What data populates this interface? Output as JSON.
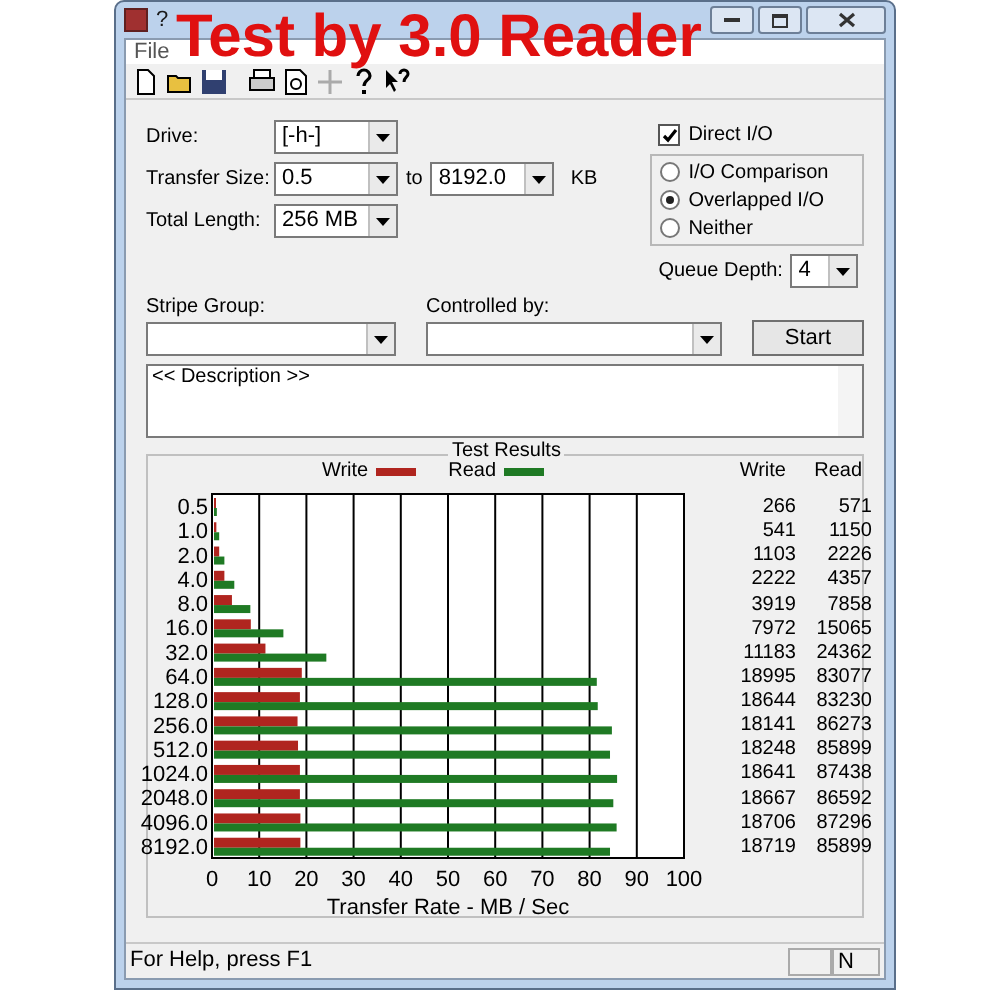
{
  "window": {
    "title_start": "?"
  },
  "overlay_text": "Test by 3.0 Reader",
  "menu": [
    "File"
  ],
  "form": {
    "drive": {
      "label": "Drive:",
      "value": "[-h-]"
    },
    "transfer_size": {
      "label": "Transfer Size:",
      "from": "0.5",
      "to_label": "to",
      "to": "8192.0",
      "unit": "KB"
    },
    "total_length": {
      "label": "Total Length:",
      "value": "256 MB"
    },
    "direct_io": {
      "label": "Direct I/O",
      "checked": true
    },
    "io_modes": [
      {
        "label": "I/O Comparison",
        "selected": false
      },
      {
        "label": "Overlapped I/O",
        "selected": true
      },
      {
        "label": "Neither",
        "selected": false
      }
    ],
    "queue_depth": {
      "label": "Queue Depth:",
      "value": "4"
    },
    "stripe_group": {
      "label": "Stripe Group:"
    },
    "controlled_by": {
      "label": "Controlled by:"
    },
    "start_button": "Start",
    "description": "<< Description >>"
  },
  "results": {
    "title": "Test Results",
    "columns": [
      "Write",
      "Read"
    ],
    "rows": [
      {
        "write": "266",
        "read": "571"
      },
      {
        "write": "541",
        "read": "1150"
      },
      {
        "write": "1103",
        "read": "2226"
      },
      {
        "write": "2222",
        "read": "4357"
      },
      {
        "write": "3919",
        "read": "7858"
      },
      {
        "write": "7972",
        "read": "15065"
      },
      {
        "write": "11183",
        "read": "24362"
      },
      {
        "write": "18995",
        "read": "83077"
      },
      {
        "write": "18644",
        "read": "83230"
      },
      {
        "write": "18141",
        "read": "86273"
      },
      {
        "write": "18248",
        "read": "85899"
      },
      {
        "write": "18641",
        "read": "87438"
      },
      {
        "write": "18667",
        "read": "86592"
      },
      {
        "write": "18706",
        "read": "87296"
      },
      {
        "write": "18719",
        "read": "85899"
      }
    ],
    "chart_data": {
      "type": "bar",
      "orientation": "horizontal",
      "xlabel": "Transfer Rate - MB / Sec",
      "categories": [
        "0.5",
        "1.0",
        "2.0",
        "4.0",
        "8.0",
        "16.0",
        "32.0",
        "64.0",
        "128.0",
        "256.0",
        "512.0",
        "1024.0",
        "2048.0",
        "4096.0",
        "8192.0"
      ],
      "series": [
        {
          "name": "Write",
          "color": "#b0251f",
          "values": [
            0.3,
            0.5,
            1.1,
            2.2,
            3.8,
            7.8,
            10.9,
            18.6,
            18.2,
            17.7,
            17.8,
            18.2,
            18.2,
            18.3,
            18.3
          ]
        },
        {
          "name": "Read",
          "color": "#1f7a24",
          "values": [
            0.6,
            1.1,
            2.2,
            4.3,
            7.7,
            14.7,
            23.8,
            81.1,
            81.3,
            84.3,
            83.9,
            85.4,
            84.6,
            85.3,
            83.9
          ]
        }
      ],
      "xlim": [
        0,
        100
      ],
      "xticks": [
        0,
        10,
        20,
        30,
        40,
        50,
        60,
        70,
        80,
        90,
        100
      ],
      "grid": true
    }
  },
  "status_bar": {
    "text": "For Help, press F1",
    "indicator": "N"
  }
}
